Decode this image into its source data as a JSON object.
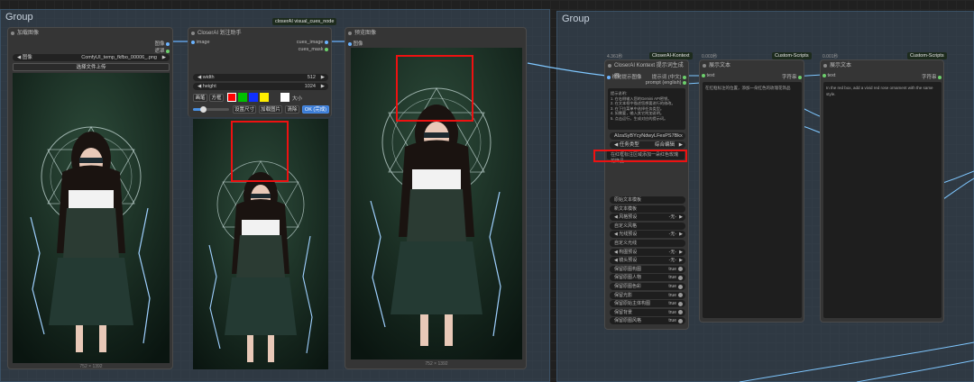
{
  "groups": [
    {
      "title": "Group"
    },
    {
      "title": "Group"
    }
  ],
  "tags": {
    "visual_cues_node": "closerAI visual_cues_node",
    "kontext": "CloserAI-Kontext",
    "custom_scripts_1": "Custom-Scripts",
    "custom_scripts_2": "Custom-Scripts"
  },
  "load_image": {
    "title": "加载图像",
    "out_image": "图像",
    "out_mask": "遮罩",
    "file_label": "图像",
    "file_value": "ComfyUI_temp_fkfbo_00006_.png",
    "upload_button": "选择文件上传",
    "caption": "752 × 1392"
  },
  "visual_cues": {
    "title": "CloserAI 划注助手",
    "in_image": "image",
    "out_cues_image": "cues_image",
    "out_cues_mask": "cues_mask",
    "width_label": "width",
    "width_value": "512",
    "height_label": "height",
    "height_value": "1024",
    "tool_brush": "画笔",
    "tool_rect": "方框",
    "size_label": "大小",
    "colors": [
      "#ff0000",
      "#00c000",
      "#1030ff",
      "#ffee00",
      "#ffffff"
    ],
    "btn_set_size": "设置尺寸",
    "btn_load_image": "加载图片",
    "btn_clear": "清除",
    "btn_ok": "OK (完成)"
  },
  "preview": {
    "title": "预览图像",
    "in_image": "图像",
    "caption": "752 × 1392"
  },
  "kontext": {
    "time": "4.361秒",
    "title": "CloserAI Kontext 提示词生成器",
    "in_image": "视觉提示图像",
    "out_prompt": "提示词 (中文)",
    "out_prompt_en": "prompt (english)",
    "instructions": "提示说明：\n1. 在右侧输入您的Gemini API密钥。\n2. 在文本框中描述您想要进行的修改。\n3. 在下拉菜单中选择任务类型。\n4. 如需要，输入其它附加说明。\n5. 点击运行，生成对应的提示词。",
    "api_key": "AIzaSyBYcyNdwyLFesPS7Bkx",
    "task_label": "任务类型",
    "task_value": "综合编辑",
    "user_input": "在红框标注区域添加一朵红色玫瑰花饰品",
    "options": [
      {
        "label": "原始文本模板",
        "kind": "plain"
      },
      {
        "label": "新文本模板",
        "kind": "plain"
      },
      {
        "label": "风格预设",
        "value": "-无-",
        "kind": "select"
      },
      {
        "label": "自定义风格",
        "kind": "plain"
      },
      {
        "label": "光线预设",
        "value": "-无-",
        "kind": "select"
      },
      {
        "label": "自定义光线",
        "kind": "plain"
      },
      {
        "label": "构图预设",
        "value": "-无-",
        "kind": "select"
      },
      {
        "label": "镜头预设",
        "value": "-无-",
        "kind": "select"
      },
      {
        "label": "保留原图构图",
        "value": "true",
        "kind": "toggle"
      },
      {
        "label": "保留原图人物",
        "value": "true",
        "kind": "toggle"
      },
      {
        "label": "保留原图色彩",
        "value": "true",
        "kind": "toggle"
      },
      {
        "label": "保留光影",
        "value": "true",
        "kind": "toggle"
      },
      {
        "label": "保留原始主体构图",
        "value": "true",
        "kind": "toggle"
      },
      {
        "label": "保留背景",
        "value": "true",
        "kind": "toggle"
      },
      {
        "label": "保留原图风格",
        "value": "true",
        "kind": "toggle"
      }
    ]
  },
  "show_text_1": {
    "time": "0.003秒",
    "title": "展示文本",
    "in_text": "text",
    "out_string": "字符串",
    "content": "在红框标注的位置，添加一朵红色的玫瑰花饰品"
  },
  "show_text_2": {
    "time": "0.001秒",
    "title": "展示文本",
    "in_text": "text",
    "out_string": "字符串",
    "content": "In the red box, add a vivid red rose ornament with the same style."
  }
}
